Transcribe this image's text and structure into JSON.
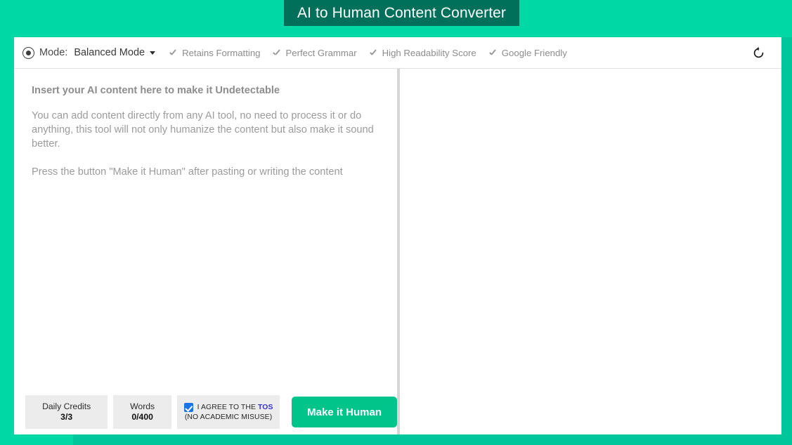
{
  "page": {
    "title": "AI to Human Content Converter",
    "background_color": "#00d9a5",
    "title_box_color": "#00705a"
  },
  "toolbar": {
    "mode_icon": "radio-selected-icon",
    "mode_label": "Mode:",
    "mode_value": "Balanced Mode",
    "caret_icon": "chevron-down-icon",
    "features": [
      {
        "icon": "check-icon",
        "label": "Retains Formatting"
      },
      {
        "icon": "check-icon",
        "label": "Perfect Grammar"
      },
      {
        "icon": "check-icon",
        "label": "High Readability Score"
      },
      {
        "icon": "check-icon",
        "label": "Google Friendly"
      }
    ],
    "refresh_icon": "refresh-icon"
  },
  "editor": {
    "placeholder_heading": "Insert your AI content here to make it Undetectable",
    "placeholder_paragraph": "You can add content directly from any AI tool, no need to process it or do anything, this tool will not only humanize the content but also make it sound better.",
    "placeholder_instruction": "Press the button \"Make it Human\" after pasting or writing the content",
    "value": ""
  },
  "output": {
    "value": ""
  },
  "footer": {
    "daily_credits_label": "Daily Credits",
    "daily_credits_value": "3/3",
    "words_label": "Words",
    "words_value": "0/400",
    "tos_text": "I AGREE TO THE",
    "tos_link": "TOS",
    "tos_sub": "(NO ACADEMIC MISUSE)",
    "tos_checked": true,
    "checkbox_color": "#1a73e8",
    "tos_link_color": "#3333cc",
    "submit_label": "Make it Human",
    "submit_color": "#00c48a"
  }
}
